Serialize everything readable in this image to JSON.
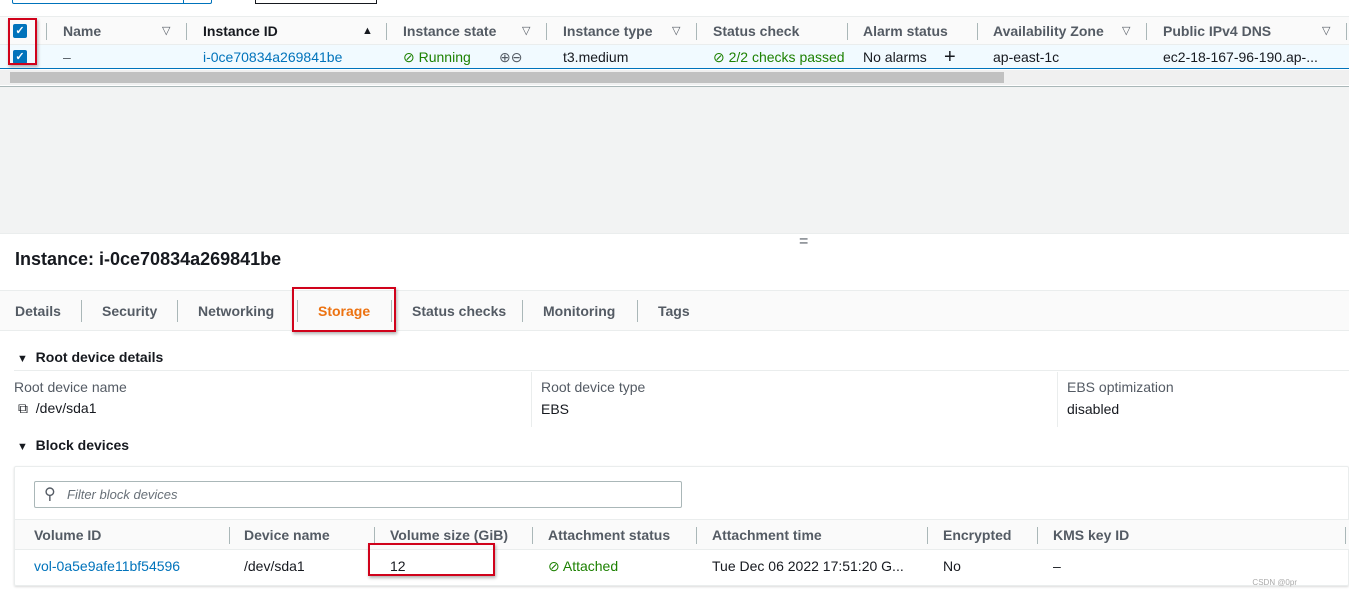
{
  "instances_table": {
    "columns": [
      {
        "label": "Name",
        "sort": "filter"
      },
      {
        "label": "Instance ID",
        "sort": "ascending"
      },
      {
        "label": "Instance state",
        "sort": "filter"
      },
      {
        "label": "Instance type",
        "sort": "filter"
      },
      {
        "label": "Status check"
      },
      {
        "label": "Alarm status"
      },
      {
        "label": "Availability Zone",
        "sort": "filter"
      },
      {
        "label": "Public IPv4 DNS",
        "sort": "filter"
      }
    ],
    "rows": [
      {
        "selected": true,
        "name": "–",
        "instance_id": "i-0ce70834a269841be",
        "state": "Running",
        "type": "t3.medium",
        "status_check": "2/2 checks passed",
        "alarm_status": "No alarms",
        "az": "ap-east-1c",
        "dns": "ec2-18-167-96-190.ap-..."
      }
    ]
  },
  "details": {
    "title": "Instance: i-0ce70834a269841be",
    "tabs": [
      {
        "label": "Details"
      },
      {
        "label": "Security"
      },
      {
        "label": "Networking"
      },
      {
        "label": "Storage",
        "active": true
      },
      {
        "label": "Status checks"
      },
      {
        "label": "Monitoring"
      },
      {
        "label": "Tags"
      }
    ],
    "root_device": {
      "heading": "Root device details",
      "fields": [
        {
          "label": "Root device name",
          "value": "/dev/sda1"
        },
        {
          "label": "Root device type",
          "value": "EBS"
        },
        {
          "label": "EBS optimization",
          "value": "disabled"
        }
      ]
    },
    "block_devices": {
      "heading": "Block devices",
      "filter_placeholder": "Filter block devices",
      "columns": [
        "Volume ID",
        "Device name",
        "Volume size (GiB)",
        "Attachment status",
        "Attachment time",
        "Encrypted",
        "KMS key ID"
      ],
      "rows": [
        {
          "volume_id": "vol-0a5e9afe11bf54596",
          "device": "/dev/sda1",
          "size": "12",
          "status": "Attached",
          "time": "Tue Dec 06 2022 17:51:20 G...",
          "encrypted": "No",
          "kms": "–"
        }
      ]
    }
  },
  "watermark": "CSDN @0pr",
  "colors": {
    "accent": "#0073bb",
    "active_tab": "#ec7211",
    "success": "#1d8102",
    "highlight": "#d0021b"
  }
}
